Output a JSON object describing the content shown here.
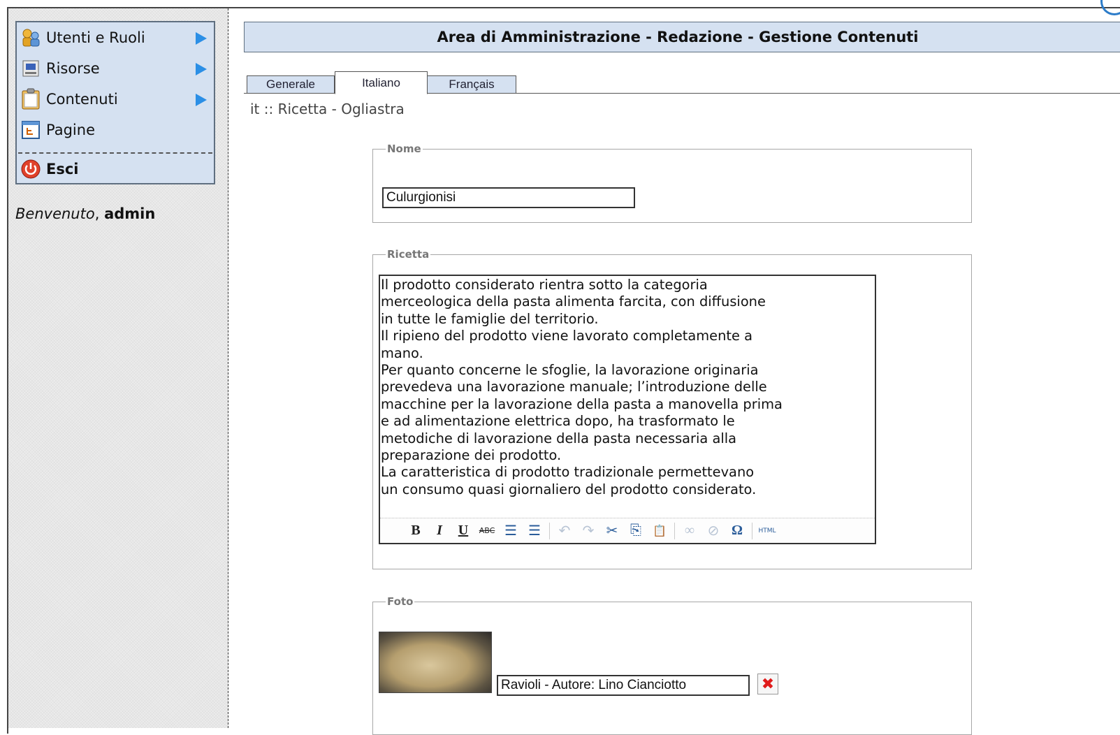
{
  "sidebar": {
    "menu": [
      {
        "label": "Utenti e Ruoli",
        "icon": "users-roles-icon",
        "has_arrow": true
      },
      {
        "label": "Risorse",
        "icon": "resources-icon",
        "has_arrow": true
      },
      {
        "label": "Contenuti",
        "icon": "clipboard-icon",
        "has_arrow": true
      },
      {
        "label": "Pagine",
        "icon": "pages-icon",
        "has_arrow": false
      }
    ],
    "exit": {
      "label": "Esci",
      "icon": "power-icon"
    },
    "welcome_prefix": "Benvenuto",
    "welcome_sep": ",",
    "welcome_user": "admin"
  },
  "header": {
    "title": "Area di Amministrazione - Redazione - Gestione Contenuti"
  },
  "tabs": [
    {
      "label": "Generale",
      "active": false
    },
    {
      "label": "Italiano",
      "active": true
    },
    {
      "label": "Français",
      "active": false
    }
  ],
  "breadcrumb": "it :: Ricetta - Ogliastra",
  "form": {
    "nome": {
      "legend": "Nome",
      "value": "Culurgionisi"
    },
    "ricetta": {
      "legend": "Ricetta",
      "text": "Il prodotto considerato rientra sotto la categoria\nmerceologica della pasta alimenta farcita, con diffusione\nin tutte le famiglie del territorio.\nIl ripieno del prodotto viene lavorato completamente a\nmano.\nPer quanto concerne le sfoglie, la lavorazione originaria\nprevedeva una lavorazione manuale; l’introduzione delle\nmacchine per la lavorazione della pasta a manovella prima\ne ad alimentazione elettrica dopo, ha trasformato le\nmetodiche di lavorazione della pasta necessaria alla\npreparazione dei prodotto.\nLa caratteristica di prodotto tradizionale permettevano\nun consumo quasi giornaliero del prodotto considerato.",
      "toolbar": {
        "bold": "B",
        "italic": "I",
        "underline": "U",
        "strike": "ABC",
        "ul": "☰",
        "ol": "☰",
        "undo": "↶",
        "redo": "↷",
        "cut": "✂",
        "copy": "⎘",
        "paste": "📋",
        "link": "∞",
        "unlink": "⊘",
        "char": "Ω",
        "html": "HTML"
      }
    },
    "foto": {
      "legend": "Foto",
      "caption": "Ravioli - Autore: Lino Cianciotto",
      "delete_label": "✖"
    }
  },
  "colors": {
    "menu_bg": "#d5e1f1",
    "arrow": "#2b8fe6",
    "delete": "#e01b1b"
  }
}
